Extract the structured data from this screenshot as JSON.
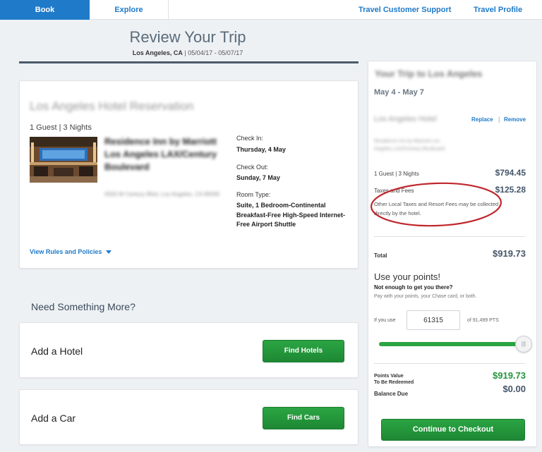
{
  "nav": {
    "book": "Book",
    "explore": "Explore",
    "support": "Travel Customer Support",
    "profile": "Travel Profile"
  },
  "header": {
    "title": "Review Your Trip",
    "location": "Los Angeles, CA",
    "dates": " | 05/04/17 - 05/07/17"
  },
  "hotel": {
    "heading": "Los Angeles Hotel Reservation",
    "guest_nights": "1 Guest | 3 Nights",
    "name": "Residence Inn by Marriott Los Angeles LAX/Century Boulevard",
    "address": "5933 W Century Blvd, Los Angeles, CA 90045",
    "check_in_label": "Check In:",
    "check_in_value": "Thursday, 4 May",
    "check_out_label": "Check Out:",
    "check_out_value": "Sunday, 7 May",
    "room_type_label": "Room Type:",
    "room_type_value": "Suite, 1 Bedroom-Continental Breakfast-Free High-Speed Internet-Free Airport Shuttle",
    "rules_link": "View Rules and Policies"
  },
  "more": {
    "heading": "Need Something More?",
    "hotel_label": "Add a Hotel",
    "hotel_button": "Find Hotels",
    "car_label": "Add a Car",
    "car_button": "Find Cars"
  },
  "summary": {
    "heading": "Your Trip to Los Angeles",
    "dates": "May 4 - May 7",
    "hotel_label": "Los Angeles Hotel",
    "replace": "Replace",
    "separator": "|",
    "remove": "Remove",
    "hotel_addr": "Residence Inn by Marriott Los Angeles LAX/Century Boulevard",
    "guest_nights": "1 Guest | 3 Nights",
    "room_amount": "$794.45",
    "taxes_label": "Taxes and Fees",
    "taxes_amount": "$125.28",
    "tax_note": "Other Local Taxes and Resort Fees may be collected directly by the hotel.",
    "total_label": "Total",
    "total_amount": "$919.73",
    "points_title": "Use your points!",
    "points_question": "Not enough to get you there?",
    "points_sub": "Pay with your points, your Chase card, or both.",
    "use_label": "If you use",
    "points_value_input": "61315",
    "of_label": "of 91,499 PTS",
    "slider_handle": "|||",
    "points_value_label": "Points Value",
    "redeem_label": "To Be Redeemed",
    "points_value_amount": "$919.73",
    "balance_label": "Balance Due",
    "balance_amount": "$0.00",
    "checkout_button": "Continue to Checkout"
  },
  "colors": {
    "brand_blue": "#1f7ac9",
    "accent_green": "#22953a",
    "annotation_red": "#c0262d"
  }
}
